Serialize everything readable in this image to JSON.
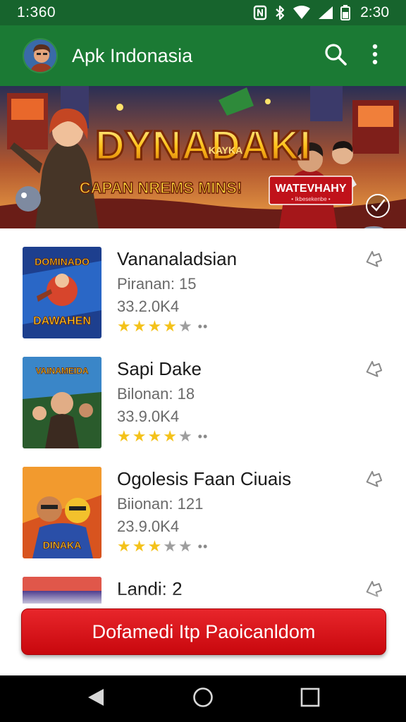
{
  "status_bar": {
    "time_left": "1:360",
    "time_right": "2:30",
    "icons": [
      "nfc-icon",
      "bluetooth-icon",
      "wifi-icon",
      "signal-icon",
      "battery-icon"
    ]
  },
  "app_bar": {
    "title": "Apk Indonasia",
    "actions": [
      "search-icon",
      "more-vert-icon"
    ]
  },
  "banner": {
    "headline": "DYNADAKI",
    "subheadline": "KAYKA",
    "tagline": "CAPAN NREMS MINS!",
    "badge_title": "WATEVHAHY",
    "badge_sub": "• Ikbesekenbe •"
  },
  "apps": [
    {
      "title": "Vananaladsian",
      "meta1": "Piranan: 15",
      "meta2": "33.2.0K4",
      "rating": 4,
      "thumb_top": "DOMINADO",
      "thumb_bottom": "DAWAHEN"
    },
    {
      "title": "Sapi Dake",
      "meta1": "Bilonan: 18",
      "meta2": "33.9.0K4",
      "rating": 4,
      "thumb_top": "VAINAMEIDA",
      "thumb_bottom": ""
    },
    {
      "title": "Ogolesis Faan Ciuais",
      "meta1": "Biionan: 121",
      "meta2": "23.9.0K4",
      "rating": 3,
      "thumb_top": "",
      "thumb_bottom": "DINAKA"
    },
    {
      "title": "Landi: 2",
      "meta1": "",
      "meta2": "",
      "rating": 0,
      "thumb_top": "",
      "thumb_bottom": ""
    }
  ],
  "cta": {
    "label": "Dofamedi Itp Paoicanldom"
  },
  "nav": [
    "back-icon",
    "home-icon",
    "recents-icon"
  ],
  "colors": {
    "status_bar": "#17642d",
    "app_bar": "#1b7a34",
    "cta": "#d81118",
    "star": "#f4c21a"
  }
}
